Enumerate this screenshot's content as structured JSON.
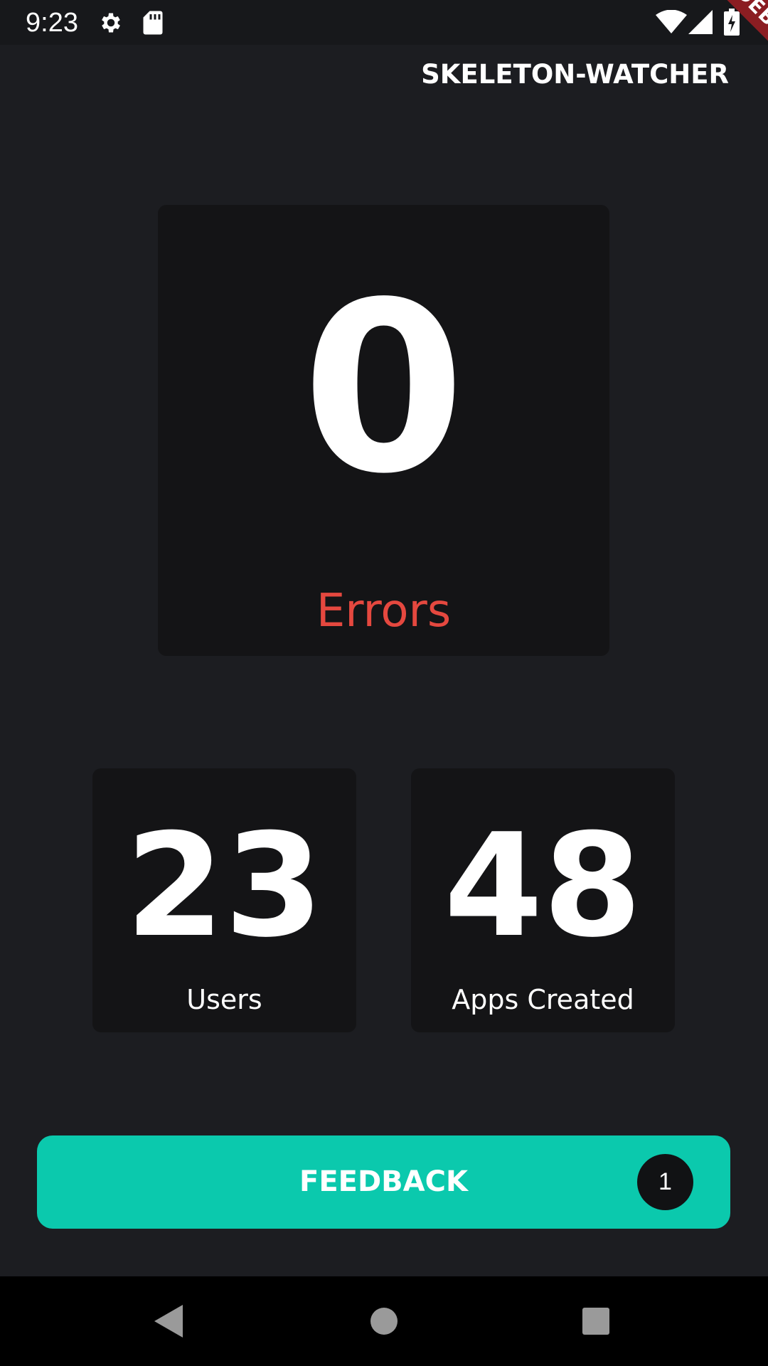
{
  "status_bar": {
    "time": "9:23",
    "icons": [
      "gear-icon",
      "sd-card-icon",
      "wifi-icon",
      "signal-icon",
      "battery-charging-icon"
    ]
  },
  "debug_banner": "DEBUG",
  "app_bar": {
    "title": "SKELETON-WATCHER"
  },
  "stats": {
    "errors": {
      "value": "0",
      "label": "Errors"
    },
    "users": {
      "value": "23",
      "label": "Users"
    },
    "apps_created": {
      "value": "48",
      "label": "Apps Created"
    }
  },
  "feedback": {
    "label": "FEEDBACK",
    "badge_count": "1"
  },
  "nav_bar": {
    "icons": [
      "back-icon",
      "home-icon",
      "recent-apps-icon"
    ]
  },
  "colors": {
    "background": "#1c1d21",
    "card": "#141416",
    "accent": "#0bc9ad",
    "error": "#e5483f",
    "debug_banner": "#8b1d22"
  }
}
